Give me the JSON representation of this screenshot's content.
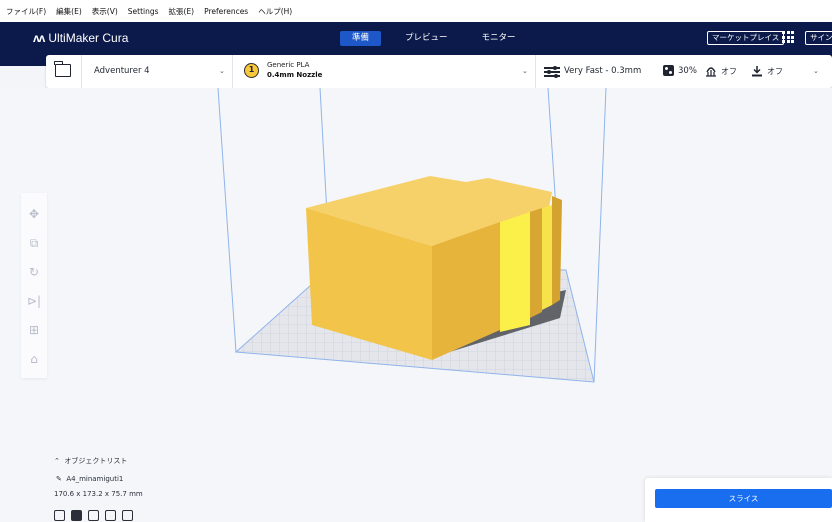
{
  "menu": [
    "ファイル(F)",
    "編集(E)",
    "表示(V)",
    "Settings",
    "拡張(E)",
    "Preferences",
    "ヘルプ(H)"
  ],
  "header": {
    "app_name": "UltiMaker Cura",
    "stages": [
      "準備",
      "プレビュー",
      "モニター"
    ],
    "marketplace_label": "マーケットプレイス",
    "signin_label": "サイン"
  },
  "toolbar": {
    "printer": "Adventurer 4",
    "extruder_number": "1",
    "material": "Generic PLA",
    "nozzle": "0.4mm Nozzle",
    "profile": "Very Fast - 0.3mm",
    "infill": "30%",
    "support": "オフ",
    "adhesion": "オフ"
  },
  "objects": {
    "header": "オブジェクトリスト",
    "name": "A4_minamiguti1",
    "dimensions": "170.6 x 173.2 x 75.7 mm"
  },
  "slice": {
    "label": "スライス"
  },
  "colors": {
    "header_bg": "#0b1a4a",
    "accent": "#196ef0",
    "model": "#f2c94c"
  }
}
